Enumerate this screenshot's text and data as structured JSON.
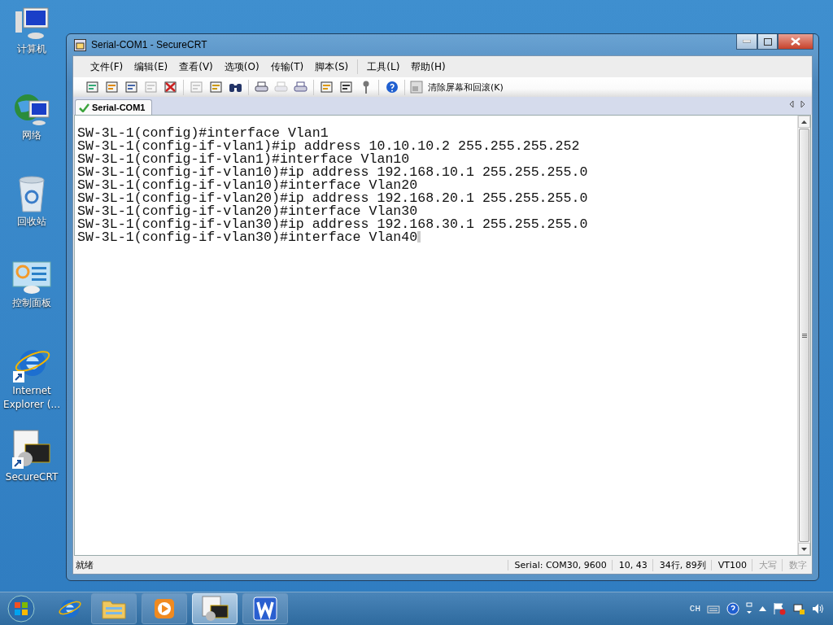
{
  "desktop_icons": [
    {
      "kind": "computer",
      "label": "计算机"
    },
    {
      "kind": "network",
      "label": "网络"
    },
    {
      "kind": "recycle",
      "label": "回收站"
    },
    {
      "kind": "control",
      "label": "控制面板"
    },
    {
      "kind": "ie",
      "label": "Internet Explorer (..."
    },
    {
      "kind": "securecrt",
      "label": "SecureCRT"
    }
  ],
  "window": {
    "title": "Serial-COM1 - SecureCRT",
    "menu": [
      "文件(F)",
      "编辑(E)",
      "查看(V)",
      "选项(O)",
      "传输(T)",
      "脚本(S)",
      "工具(L)",
      "帮助(H)"
    ],
    "toolbar": [
      [
        {
          "kind": "connect",
          "disabled": false
        },
        {
          "kind": "quick-connect",
          "disabled": false
        },
        {
          "kind": "tab",
          "disabled": false
        },
        {
          "kind": "reconnect",
          "disabled": true
        },
        {
          "kind": "disconnect",
          "disabled": false
        }
      ],
      [
        {
          "kind": "copy",
          "disabled": true
        },
        {
          "kind": "paste",
          "disabled": false
        },
        {
          "kind": "find",
          "disabled": false
        }
      ],
      [
        {
          "kind": "print-screen",
          "disabled": false
        },
        {
          "kind": "print-sel",
          "disabled": true
        },
        {
          "kind": "print",
          "disabled": false
        }
      ],
      [
        {
          "kind": "options",
          "disabled": false
        },
        {
          "kind": "map",
          "disabled": false
        },
        {
          "kind": "key",
          "disabled": false
        }
      ],
      [
        {
          "kind": "help",
          "disabled": false
        }
      ]
    ],
    "clear_button": "清除屏幕和回滚(K)",
    "tabs": [
      {
        "label": "Serial-COM1",
        "selected": true
      }
    ],
    "terminal_lines": [
      "SW-3L-1(config)#interface Vlan1",
      "SW-3L-1(config-if-vlan1)#ip address 10.10.10.2 255.255.255.252",
      "SW-3L-1(config-if-vlan1)#interface Vlan10",
      "SW-3L-1(config-if-vlan10)#ip address 192.168.10.1 255.255.255.0",
      "SW-3L-1(config-if-vlan10)#interface Vlan20",
      "SW-3L-1(config-if-vlan20)#ip address 192.168.20.1 255.255.255.0",
      "SW-3L-1(config-if-vlan20)#interface Vlan30",
      "SW-3L-1(config-if-vlan30)#ip address 192.168.30.1 255.255.255.0",
      "SW-3L-1(config-if-vlan30)#interface Vlan40"
    ],
    "status_bar": {
      "message": "就绪",
      "panes": [
        {
          "text": "Serial: COM30, 9600",
          "disabled": false
        },
        {
          "text": "10,  43",
          "disabled": false
        },
        {
          "text": "34行, 89列",
          "disabled": false
        },
        {
          "text": "VT100",
          "disabled": false
        },
        {
          "text": "大写",
          "disabled": true
        },
        {
          "text": "数字",
          "disabled": true
        }
      ]
    }
  },
  "taskbar": {
    "apps": [
      {
        "kind": "ie",
        "selected": false
      },
      {
        "kind": "explorer",
        "selected": false
      },
      {
        "kind": "media",
        "selected": false
      },
      {
        "kind": "securecrt",
        "selected": true
      },
      {
        "kind": "wps",
        "selected": false
      }
    ],
    "language": "CH"
  }
}
